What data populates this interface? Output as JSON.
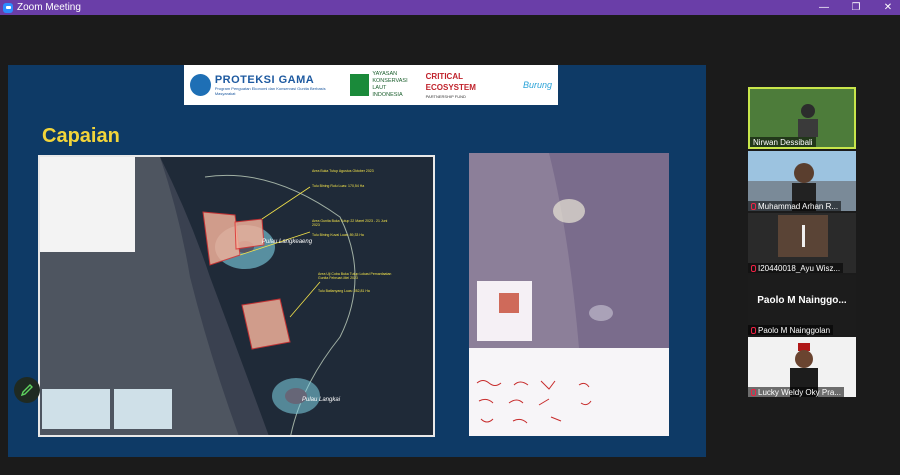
{
  "window": {
    "title": "Zoom Meeting"
  },
  "slide": {
    "logos": {
      "proteksi": "PROTEKSI GAMA",
      "proteksi_sub": "Program Penguatan Ekonomi dan Konservasi Gunita Berbasis Masyarakat",
      "ykl_line1": "YAYASAN",
      "ykl_line2": "KONSERVASI",
      "ykl_line3": "LAUT INDONESIA",
      "cepf_a": "CRITICAL",
      "cepf_b": "ECOSYSTEM",
      "cepf_c": "PARTNERSHIP FUND",
      "burung": "Burung"
    },
    "heading": "Capaian",
    "map_labels": {
      "island1": "Pulau Langkeaeng",
      "island2": "Pulau Langkai",
      "callout1": "Area Buka Tutup Agustus Oktober 2023",
      "callout1b": "Tulu Bining Rulu Luas: 170,54 Ha",
      "callout2": "Area Gunita Buka Tutup 22 Maret 2023 - 21 Juni 2023",
      "callout2b": "Tulu Bining Kuvai Luas: 89,33 Ha",
      "callout3": "Area Uji Coba Buka Tutup Lokasi Pemanfaatan Gunita Februari-Mei 2023",
      "callout3b": "Tulu Batlanyang Luas: 282,81 Ha"
    }
  },
  "participants": [
    {
      "name": "Nirwan Dessibali",
      "active": true
    },
    {
      "name": "Muhammad Arhan R..."
    },
    {
      "name": "I20440018_Ayu Wisz..."
    },
    {
      "name": "Paolo M Nainggolan",
      "big_label": "Paolo M Nainggo..."
    },
    {
      "name": "Lucky Weldy Oky Pra..."
    }
  ]
}
